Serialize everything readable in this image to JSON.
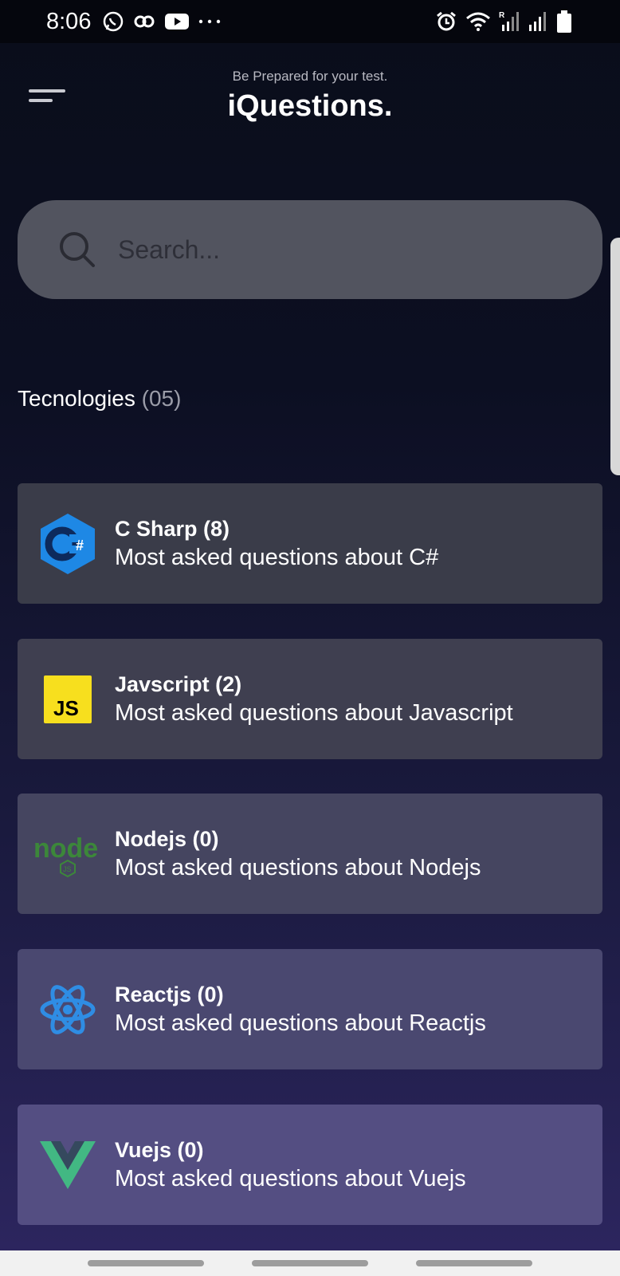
{
  "status_bar": {
    "time": "8:06",
    "left_icons": [
      "whatsapp-icon",
      "link-icon",
      "youtube-icon",
      "more-dots-icon"
    ],
    "right_icons": [
      "alarm-icon",
      "wifi-icon",
      "signal-r-icon",
      "signal-icon",
      "battery-icon"
    ]
  },
  "header": {
    "subtitle": "Be Prepared for your test.",
    "title": "iQuestions.",
    "menu_icon": "menu-icon"
  },
  "search": {
    "placeholder": "Search...",
    "value": ""
  },
  "technologies": {
    "label": "Tecnologies",
    "count": "(05)",
    "items": [
      {
        "title": "C Sharp (8)",
        "description": "Most asked questions about C#",
        "icon": "csharp-logo-icon",
        "bg": "#3a3c49"
      },
      {
        "title": "Javscript (2)",
        "description": "Most asked questions about Javascript",
        "icon": "javascript-logo-icon",
        "bg": "#3f3f50"
      },
      {
        "title": "Nodejs (0)",
        "description": "Most asked questions about Nodejs",
        "icon": "nodejs-logo-icon",
        "bg": "#454560"
      },
      {
        "title": "Reactjs (0)",
        "description": "Most asked questions about Reactjs",
        "icon": "react-logo-icon",
        "bg": "#4a4870"
      },
      {
        "title": "Vuejs (0)",
        "description": "Most asked questions about Vuejs",
        "icon": "vue-logo-icon",
        "bg": "#544e82"
      }
    ]
  },
  "colors": {
    "search_bg": "#52545f",
    "csharp": "#239120",
    "javascript": "#f7df1e",
    "nodejs": "#3c873a",
    "react": "#61dafb",
    "vue": "#42b883"
  }
}
